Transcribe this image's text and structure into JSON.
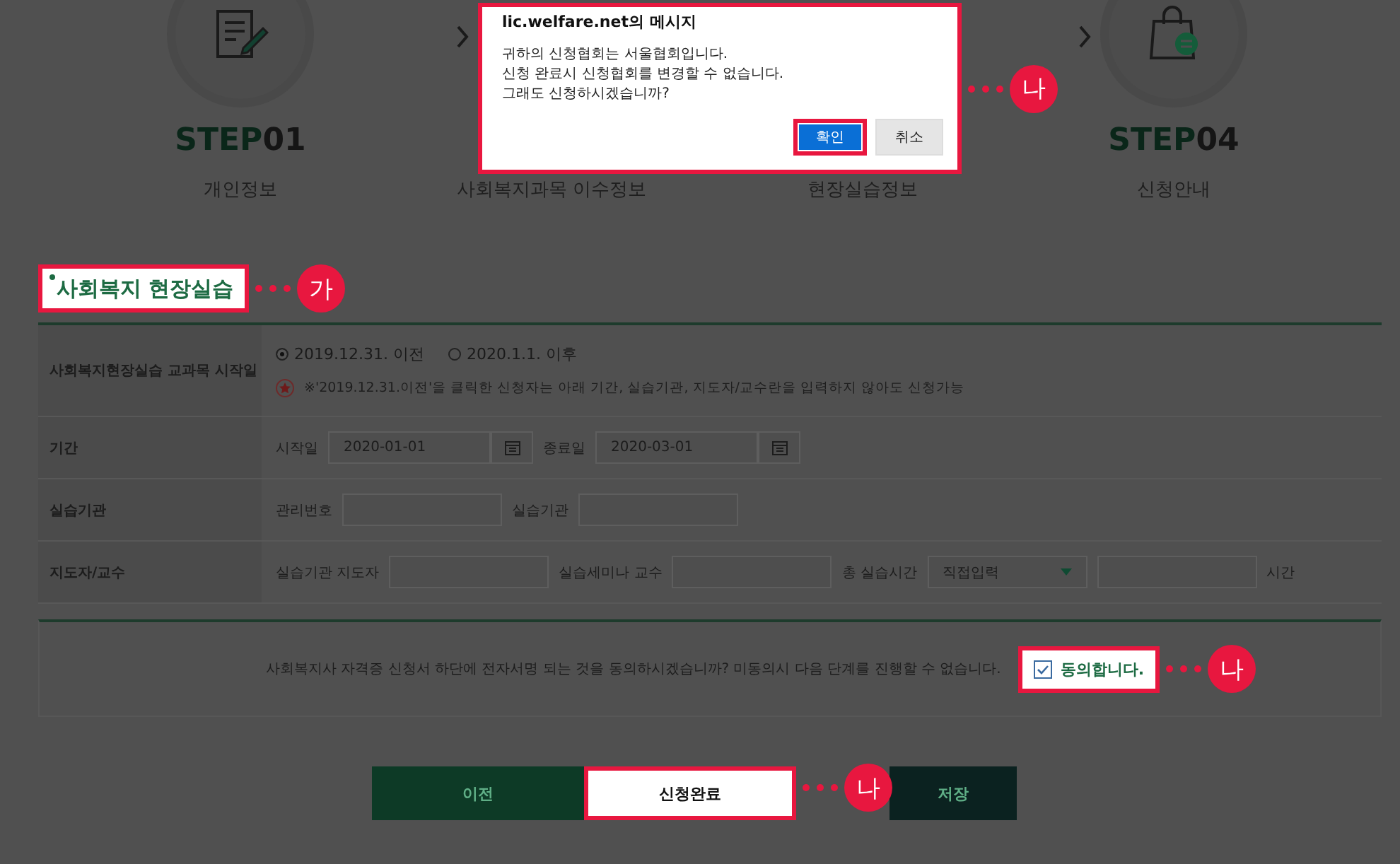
{
  "steps": [
    {
      "kind": "document",
      "step_word": "STEP",
      "number": "01",
      "label": "개인정보"
    },
    {
      "kind": "covered",
      "label": "사회복지과목 이수정보"
    },
    {
      "kind": "covered",
      "label": "현장실습정보"
    },
    {
      "kind": "bag",
      "step_word": "STEP",
      "number": "04",
      "label": "신청안내"
    }
  ],
  "dialog": {
    "title": "lic.welfare.net의 메시지",
    "lines": [
      "귀하의 신청협회는 서울협회입니다.",
      "신청 완료시 신청협회를 변경할 수 없습니다.",
      "그래도 신청하시겠습니까?"
    ],
    "highlighted": true,
    "callout": "나",
    "buttons": [
      {
        "label": "확인",
        "kind": "primary",
        "highlighted": true
      },
      {
        "label": "취소",
        "kind": "secondary",
        "highlighted": false
      }
    ]
  },
  "section": {
    "title": "사회복지 현장실습",
    "highlighted": true,
    "callout": "가"
  },
  "form": {
    "rows": [
      {
        "label": "사회복지현장실습 교과목 시작일",
        "kind": "radios",
        "options": [
          {
            "label": "2019.12.31. 이전",
            "selected": true
          },
          {
            "label": "2020.1.1. 이후",
            "selected": false
          }
        ],
        "notice": "※'2019.12.31.이전'을 클릭한 신청자는 아래 기간, 실습기관, 지도자/교수란을 입력하지 않아도 신청가능"
      },
      {
        "label": "기간",
        "kind": "fields",
        "fields": [
          {
            "label": "시작일",
            "kind": "date",
            "value": "2020-01-01"
          },
          {
            "label": "종료일",
            "kind": "date",
            "value": "2020-03-01"
          }
        ]
      },
      {
        "label": "실습기관",
        "kind": "fields",
        "fields": [
          {
            "label": "관리번호",
            "kind": "text"
          },
          {
            "label": "실습기관",
            "kind": "text"
          }
        ]
      },
      {
        "label": "지도자/교수",
        "kind": "fields",
        "fields": [
          {
            "label": "실습기관 지도자",
            "kind": "text"
          },
          {
            "label": "실습세미나 교수",
            "kind": "text"
          },
          {
            "label": "총 실습시간",
            "kind": "select",
            "value": "직접입력"
          },
          {
            "kind": "text",
            "suffix": "시간"
          }
        ]
      }
    ]
  },
  "agreement": {
    "text": "사회복지사 자격증 신청서 하단에 전자서명 되는 것을 동의하시겠습니까? 미동의시 다음 단계를 진행할 수 없습니다.",
    "checkbox": {
      "label": "동의합니다.",
      "checked": true,
      "highlighted": true
    },
    "callout": "나"
  },
  "buttons": [
    {
      "label": "이전",
      "kind": "prev",
      "highlighted": false
    },
    {
      "label": "신청완료",
      "kind": "submit",
      "highlighted": true,
      "callout": "나"
    },
    {
      "label": "저장",
      "kind": "save",
      "highlighted": false
    }
  ]
}
